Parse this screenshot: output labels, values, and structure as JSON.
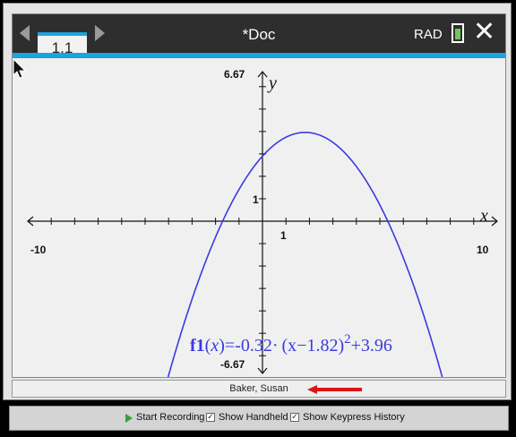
{
  "titlebar": {
    "tab_label": "1.1",
    "doc_title": "*Doc",
    "angle_mode": "RAD",
    "close_glyph": "✕"
  },
  "graph": {
    "x_min_label": "-10",
    "x_max_label": "10",
    "y_max_label": "6.67",
    "y_min_label": "-6.67",
    "x_unit_label": "1",
    "y_unit_label": "1",
    "x_axis_name": "x",
    "y_axis_name": "y",
    "function_label": {
      "name": "f1",
      "arg": "x",
      "expr_a": "=-0.32·",
      "expr_b": "(x−1.82)",
      "exponent": "2",
      "expr_c": "+3.96"
    },
    "curve_color": "#3a3ae0"
  },
  "chart_data": {
    "type": "line",
    "series": [
      {
        "function": "f1(x)=-0.32·(x-1.82)^2+3.96",
        "a": -0.32,
        "h": 1.82,
        "k": 3.96
      }
    ],
    "xlim": [
      -10,
      10
    ],
    "ylim": [
      -6.67,
      6.67
    ],
    "xlabel": "x",
    "ylabel": "y",
    "grid": false
  },
  "footer": {
    "owner": "Baker, Susan"
  },
  "bottom_bar": {
    "start_recording": "Start Recording",
    "show_handheld": "Show Handheld",
    "show_keypress_history": "Show Keypress History"
  },
  "colors": {
    "accent": "#1da3de",
    "arrow": "#e01414",
    "play": "#2fa33a"
  }
}
